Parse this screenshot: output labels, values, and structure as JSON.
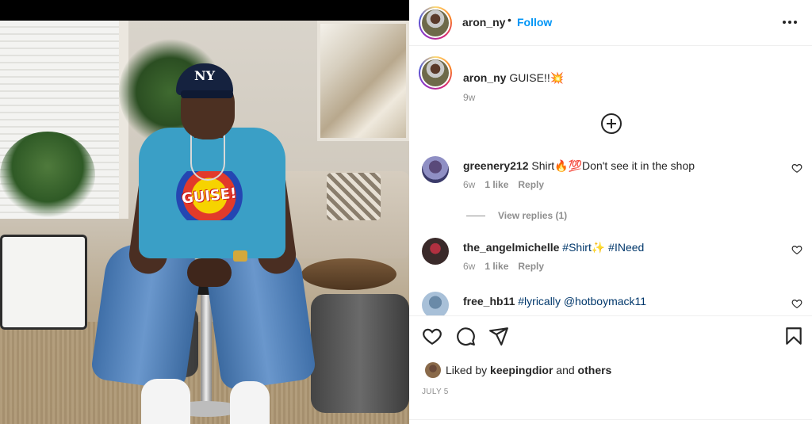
{
  "post": {
    "author": "aron_ny",
    "follow_label": "Follow",
    "separator": "•",
    "caption_user": "aron_ny",
    "caption_text": "GUISE!!💥",
    "caption_time": "9w",
    "photo": {
      "cap_text": "NY",
      "shirt_text": "GUISE!"
    }
  },
  "comments": [
    {
      "user": "greenery212",
      "text": "Shirt🔥💯Don't see it in the shop",
      "time": "6w",
      "likes": "1 like",
      "reply_label": "Reply",
      "view_replies": "View replies (1)"
    },
    {
      "user": "the_angelmichelle",
      "text": "#Shirt✨ #INeed",
      "time": "6w",
      "likes": "1 like",
      "reply_label": "Reply"
    },
    {
      "user": "free_hb11",
      "text": "#lyrically @hotboymack11"
    }
  ],
  "likes": {
    "prefix": "Liked by",
    "user": "keepingdior",
    "and": "and",
    "others": "others"
  },
  "date": "JULY 5",
  "icons": {
    "more": "more-horizontal-icon",
    "load_more": "plus-circle-icon",
    "like": "heart-icon",
    "comment": "comment-icon",
    "share": "send-icon",
    "save": "bookmark-icon"
  },
  "colors": {
    "accent": "#0095f6",
    "text": "#262626",
    "muted": "#8e8e8e",
    "hashtag": "#00376b"
  }
}
